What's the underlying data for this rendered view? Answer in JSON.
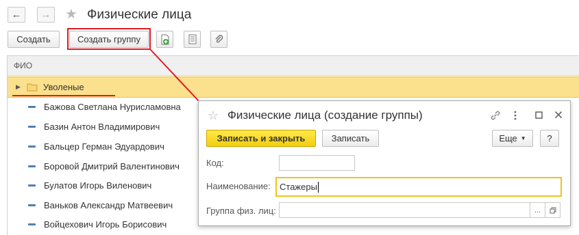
{
  "window": {
    "title": "Физические лица",
    "nav_back": "←",
    "nav_forward": "→",
    "star": "★"
  },
  "toolbar": {
    "create_label": "Создать",
    "create_group_label": "Создать группу"
  },
  "table": {
    "column_header": "ФИО",
    "rows": [
      {
        "name": "Уволеные",
        "is_group": true,
        "selected": true
      },
      {
        "name": "Бажова Светлана Нурисламовна"
      },
      {
        "name": "Базин Антон Владимирович"
      },
      {
        "name": "Бальцер Герман Эдуардович"
      },
      {
        "name": "Боровой Дмитрий Валентинович"
      },
      {
        "name": "Булатов Игорь Виленович"
      },
      {
        "name": "Ваньков Александр Матвеевич"
      },
      {
        "name": "Войцехович Игорь Борисович"
      }
    ]
  },
  "dialog": {
    "title": "Физические лица (создание группы)",
    "star": "☆",
    "save_close_label": "Записать и закрыть",
    "save_label": "Записать",
    "more_label": "Еще",
    "help_label": "?",
    "fields": {
      "code_label": "Код:",
      "code_value": "",
      "name_label": "Наименование:",
      "name_value": "Стажеры",
      "group_label": "Группа физ. лиц:",
      "group_value": "",
      "ellipsis": "..."
    }
  },
  "colors": {
    "accent_yellow": "#f2cd10",
    "selection": "#fbe08d",
    "annotation_red": "#e01b23"
  }
}
